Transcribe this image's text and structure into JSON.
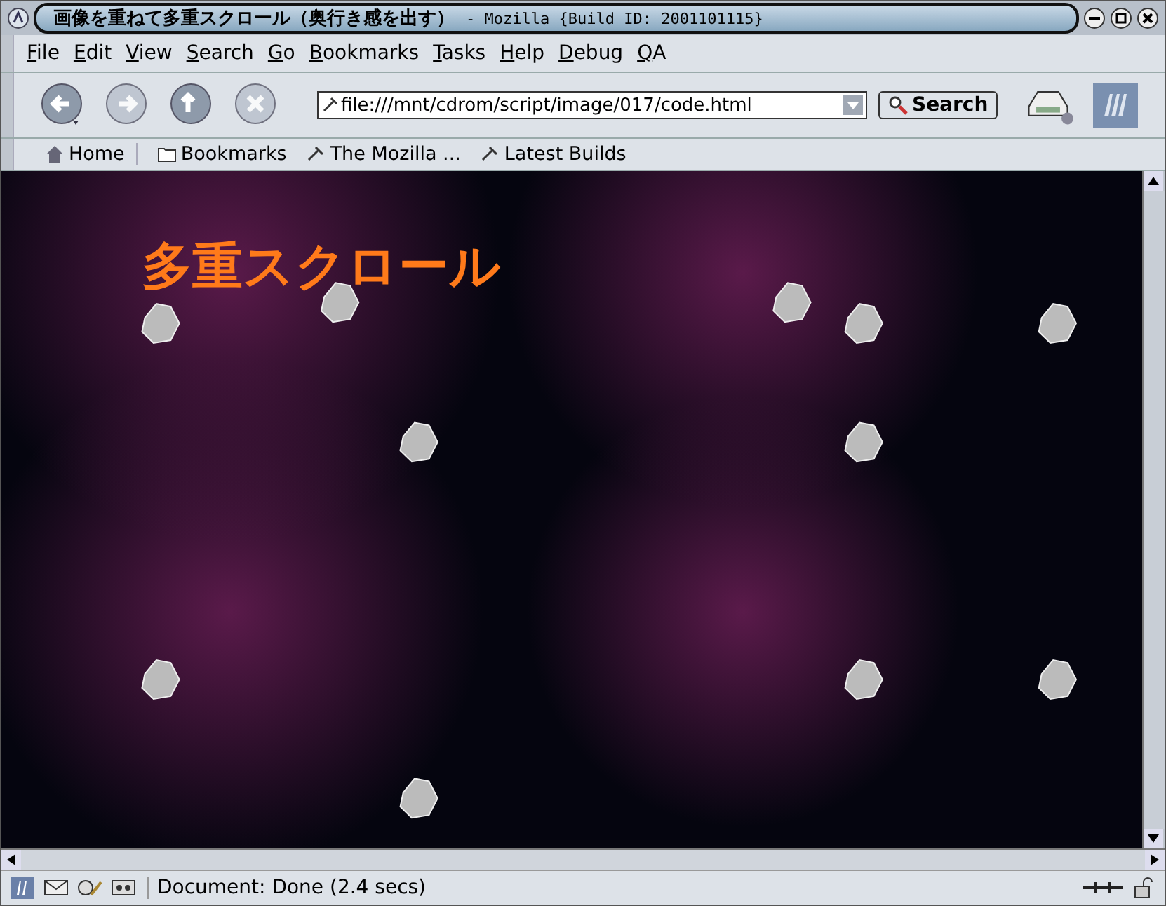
{
  "window": {
    "title": "画像を重ねて多重スクロール（奥行き感を出す）",
    "title_suffix": "- Mozilla {Build ID: 2001101115}"
  },
  "menu": [
    "File",
    "Edit",
    "View",
    "Search",
    "Go",
    "Bookmarks",
    "Tasks",
    "Help",
    "Debug",
    "QA"
  ],
  "nav_buttons": [
    {
      "kind": "back",
      "disabled": false
    },
    {
      "kind": "forward",
      "disabled": true
    },
    {
      "kind": "reload",
      "disabled": false
    },
    {
      "kind": "stop",
      "disabled": true
    }
  ],
  "url": "file:///mnt/cdrom/script/image/017/code.html",
  "search_button": "Search",
  "bookmarks": [
    {
      "label": "Home",
      "kind": "home"
    },
    {
      "label": "Bookmarks",
      "kind": "folder"
    },
    {
      "label": "The Mozilla ...",
      "kind": "link"
    },
    {
      "label": "Latest Builds",
      "kind": "link"
    }
  ],
  "page": {
    "heading": "多重スクロール"
  },
  "status": "Document: Done (2.4 secs)"
}
